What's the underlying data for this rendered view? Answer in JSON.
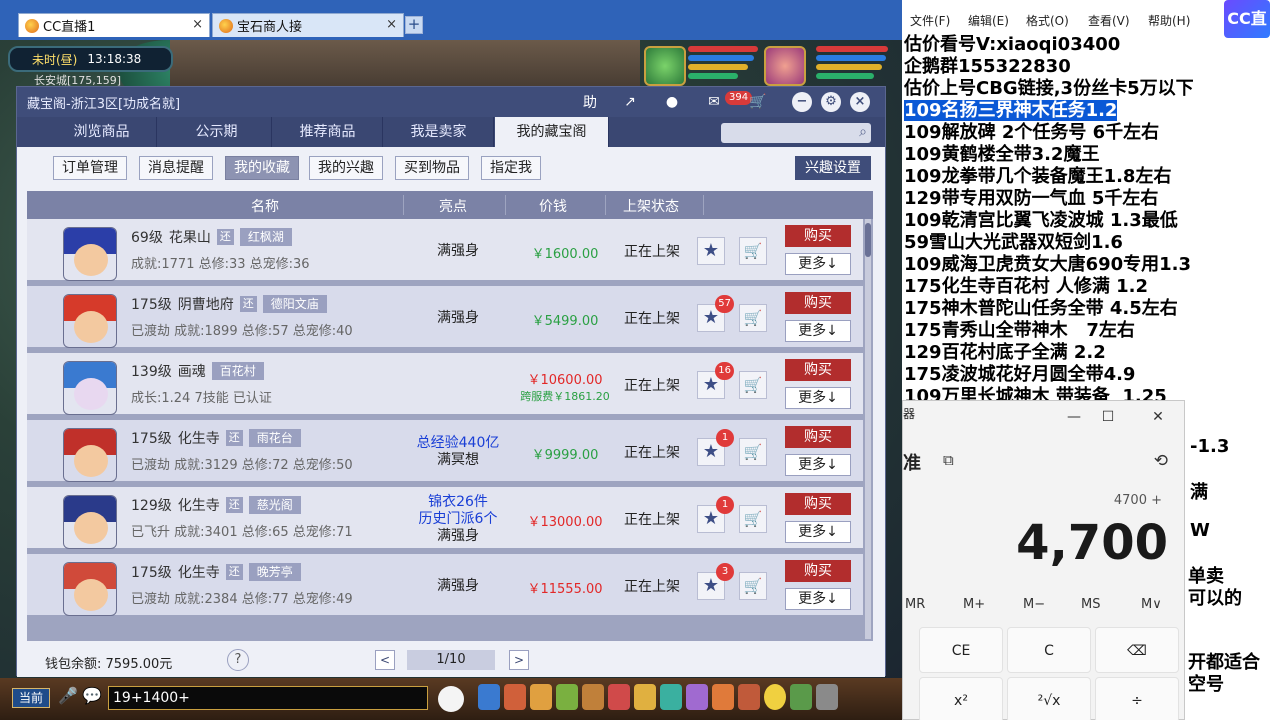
{
  "browser": {
    "tabs": [
      {
        "label": "CC直播1",
        "close": "×"
      },
      {
        "label": "宝石商人接",
        "close": "×"
      }
    ],
    "new_tab": "+"
  },
  "game_hud": {
    "time_period": "未时(昼)",
    "clock": "13:18:38",
    "location": "长安城[175,159]"
  },
  "cbg": {
    "title": "藏宝阁-浙江3区[功成名就]",
    "title_buttons": {
      "help": "助",
      "share": "↗",
      "record": "●",
      "message_badge": "394",
      "cart": "🛒",
      "minimize": "−",
      "settings": "⚙",
      "close": "×"
    },
    "nav_tabs": [
      "浏览商品",
      "公示期",
      "推荐商品",
      "我是卖家",
      "我的藏宝阁"
    ],
    "sub_tabs": [
      "订单管理",
      "消息提醒",
      "我的收藏",
      "我的兴趣",
      "买到物品",
      "指定我"
    ],
    "interest_button": "兴趣设置",
    "columns": {
      "name": "名称",
      "highlight": "亮点",
      "price": "价钱",
      "status": "上架状态"
    },
    "rows": [
      {
        "level": "69级",
        "school": "花果山",
        "reborn": "还",
        "server": "红枫湖",
        "line2": "成就:1771  总修:33  总宠修:36",
        "highlight": [
          "满强身"
        ],
        "highlight_color": [
          "dark"
        ],
        "price": "￥1600.00",
        "price_color": "green",
        "fee": "",
        "status": "正在上架",
        "fav_count": "",
        "buy": "购买",
        "more": "更多↓"
      },
      {
        "level": "175级",
        "school": "阴曹地府",
        "reborn": "还",
        "server": "德阳文庙",
        "line2": "已渡劫  成就:1899  总修:57  总宠修:40",
        "highlight": [
          "满强身"
        ],
        "highlight_color": [
          "dark"
        ],
        "price": "￥5499.00",
        "price_color": "green",
        "fee": "",
        "status": "正在上架",
        "fav_count": "57",
        "buy": "购买",
        "more": "更多↓"
      },
      {
        "level": "139级",
        "school": "画魂",
        "reborn": "",
        "server": "百花村",
        "line2": "成长:1.24  7技能  已认证",
        "highlight": [],
        "highlight_color": [],
        "price": "￥10600.00",
        "price_color": "red",
        "fee": "跨服费￥1861.20",
        "status": "正在上架",
        "fav_count": "16",
        "buy": "购买",
        "more": "更多↓"
      },
      {
        "level": "175级",
        "school": "化生寺",
        "reborn": "还",
        "server": "雨花台",
        "line2": "已渡劫  成就:3129  总修:72  总宠修:50",
        "highlight": [
          "总经验440亿",
          "满冥想"
        ],
        "highlight_color": [
          "blue",
          "dark"
        ],
        "price": "￥9999.00",
        "price_color": "green",
        "fee": "",
        "status": "正在上架",
        "fav_count": "1",
        "buy": "购买",
        "more": "更多↓"
      },
      {
        "level": "129级",
        "school": "化生寺",
        "reborn": "还",
        "server": "慈光阁",
        "line2": "已飞升  成就:3401  总修:65  总宠修:71",
        "highlight": [
          "锦衣26件",
          "历史门派6个",
          "满强身"
        ],
        "highlight_color": [
          "blue",
          "blue",
          "dark"
        ],
        "price": "￥13000.00",
        "price_color": "red",
        "fee": "",
        "status": "正在上架",
        "fav_count": "1",
        "buy": "购买",
        "more": "更多↓"
      },
      {
        "level": "175级",
        "school": "化生寺",
        "reborn": "还",
        "server": "晚芳亭",
        "line2": "已渡劫  成就:2384  总修:77  总宠修:49",
        "highlight": [
          "满强身"
        ],
        "highlight_color": [
          "dark"
        ],
        "price": "￥11555.00",
        "price_color": "red",
        "fee": "",
        "status": "正在上架",
        "fav_count": "3",
        "buy": "购买",
        "more": "更多↓"
      }
    ],
    "footer": {
      "wallet": "钱包余额:  7595.00元",
      "help": "?",
      "prev": "<",
      "page": "1/10",
      "next": ">"
    }
  },
  "game_bar": {
    "chat_channel": "当前",
    "chat_input": "19+1400+"
  },
  "notepad": {
    "menu": [
      "文件(F)",
      "编辑(E)",
      "格式(O)",
      "查看(V)",
      "帮助(H)"
    ],
    "lines": [
      "估价看号V:xiaoqi03400",
      "企鹅群155322830",
      "估价上号CBG链接,3份丝卡5万以下",
      "109名扬三界神木任务1.2",
      "109解放碑 2个任务号 6千左右",
      "109黄鹤楼全带3.2魔王",
      "109龙拳带几个装备魔王1.8左右",
      "129带专用双防一气血 5千左右",
      "109乾清宫比翼飞凌波城 1.3最低",
      "59雪山大光武器双短剑1.6",
      "109威海卫虎贲女大唐690专用1.3",
      "175化生寺百花村 人修满 1.2",
      "175神木普陀山任务全带 4.5左右",
      "175青秀山全带神木   7左右",
      "129百花村底子全满 2.2",
      "175凌波城花好月圆全带4.9",
      "109万里长城神木 带装备  1.25"
    ],
    "highlight_line_index": 3,
    "tail_fragments": [
      "-1.3",
      "满",
      "W",
      "单卖",
      "可以的",
      "开都适合",
      "空号"
    ],
    "logo": "CC直播"
  },
  "calculator": {
    "title": "器",
    "mode": "准",
    "expression": "4700 +",
    "display": "4,700",
    "memory": [
      "MR",
      "M+",
      "M−",
      "MS",
      "M∨"
    ],
    "keys_row1": [
      "CE",
      "C",
      "⌫"
    ],
    "keys_row2": [
      "x²",
      "²√x",
      "÷"
    ],
    "window_buttons": [
      "—",
      "☐",
      "✕"
    ]
  }
}
